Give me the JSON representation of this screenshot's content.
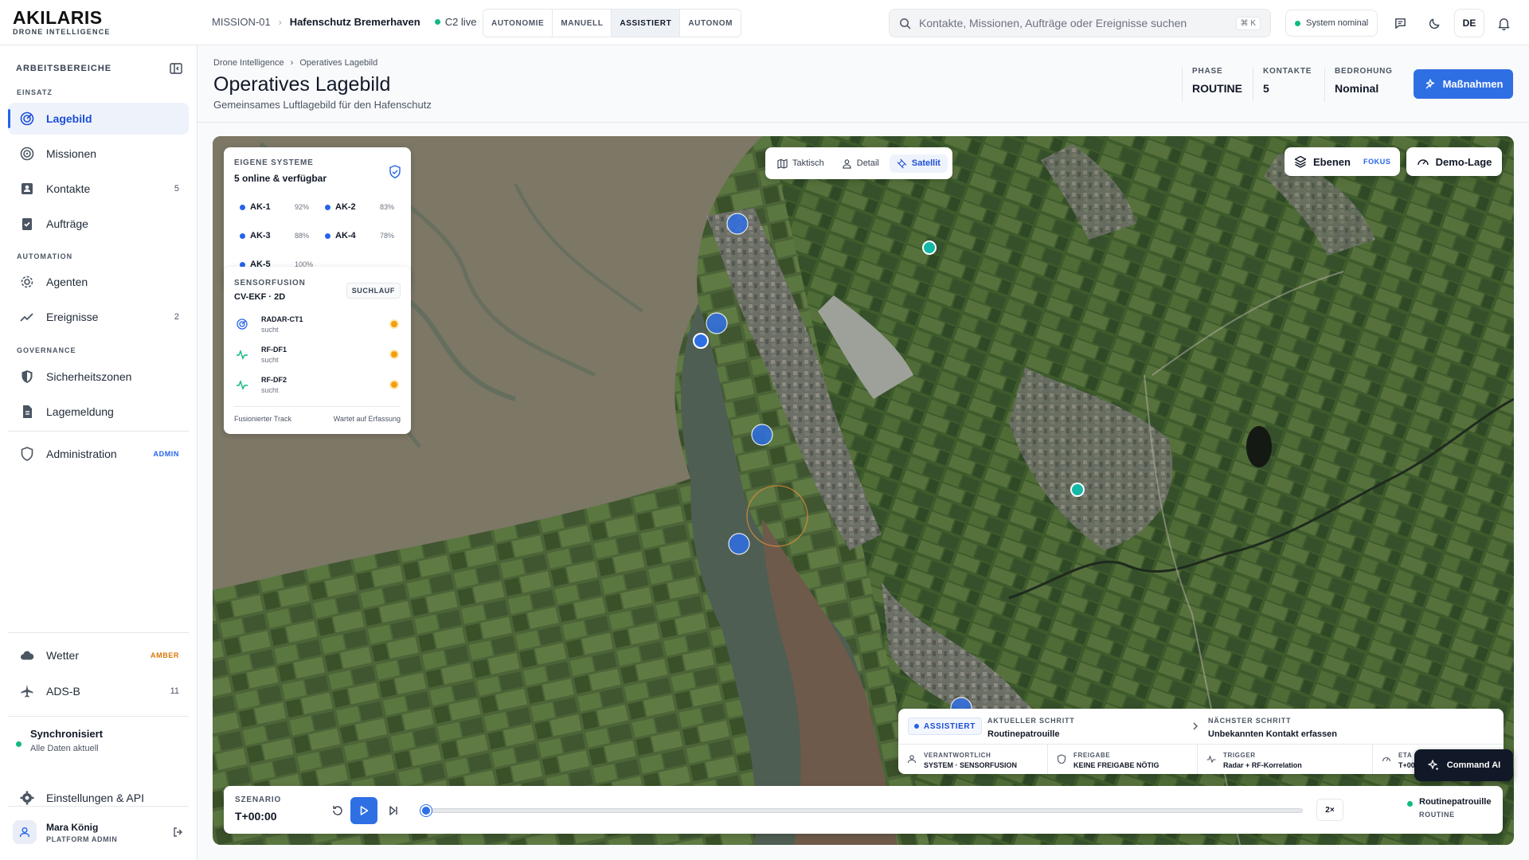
{
  "brand": {
    "name": "AKILARIS",
    "tagline": "DRONE INTELLIGENCE"
  },
  "topbar": {
    "mission": "MISSION-01",
    "site": "Hafenschutz Bremerhaven",
    "c2_status": "C2 live",
    "modes": [
      "AUTONOMIE",
      "MANUELL",
      "ASSISTIERT",
      "AUTONOM"
    ],
    "active_mode": "ASSISTIERT",
    "search_placeholder": "Kontakte, Missionen, Aufträge oder Ereignisse suchen",
    "search_shortcut": "⌘ K",
    "system_status": "System nominal",
    "language": "DE"
  },
  "sidebar": {
    "title": "ARBEITSBEREICHE",
    "sections": {
      "einsatz": "EINSATZ",
      "automation": "AUTOMATION",
      "governance": "GOVERNANCE"
    },
    "items": [
      {
        "label": "Lagebild",
        "icon": "radar-icon",
        "active": true
      },
      {
        "label": "Missionen",
        "icon": "target-icon"
      },
      {
        "label": "Kontakte",
        "icon": "contacts-icon",
        "count": "5"
      },
      {
        "label": "Aufträge",
        "icon": "clipboard-check-icon"
      },
      {
        "label": "Agenten",
        "icon": "gear-icon"
      },
      {
        "label": "Ereignisse",
        "icon": "trend-icon",
        "count": "2"
      },
      {
        "label": "Sicherheitszonen",
        "icon": "shield-half-icon"
      },
      {
        "label": "Lagemeldung",
        "icon": "document-icon"
      },
      {
        "label": "Administration",
        "icon": "shield-icon",
        "tag": "ADMIN"
      },
      {
        "label": "Wetter",
        "icon": "cloud-icon",
        "tag": "AMBER"
      },
      {
        "label": "ADS-B",
        "icon": "plane-icon",
        "count": "11"
      }
    ],
    "sync": {
      "title": "Synchronisiert",
      "detail": "Alle Daten aktuell"
    },
    "settings": "Einstellungen & API",
    "user": {
      "name": "Mara König",
      "role": "PLATFORM ADMIN"
    }
  },
  "header": {
    "breadcrumb": [
      "Drone Intelligence",
      "Operatives Lagebild"
    ],
    "title": "Operatives Lagebild",
    "subtitle": "Gemeinsames Luftlagebild für den Hafenschutz",
    "stats": [
      {
        "label": "PHASE",
        "value": "ROUTINE"
      },
      {
        "label": "KONTAKTE",
        "value": "5"
      },
      {
        "label": "BEDROHUNG",
        "value": "Nominal"
      }
    ],
    "action": "Maßnahmen"
  },
  "map": {
    "systems": {
      "label": "EIGENE SYSTEME",
      "summary": "5 online & verfügbar",
      "units": [
        {
          "id": "AK-1",
          "battery": "92%"
        },
        {
          "id": "AK-2",
          "battery": "83%"
        },
        {
          "id": "AK-3",
          "battery": "88%"
        },
        {
          "id": "AK-4",
          "battery": "78%"
        },
        {
          "id": "AK-5",
          "battery": "100%"
        }
      ]
    },
    "fusion": {
      "label": "SENSORFUSION",
      "model": "CV-EKF · 2D",
      "badge": "SUCHLAUF",
      "sensors": [
        {
          "name": "RADAR-CT1",
          "state": "sucht"
        },
        {
          "name": "RF-DF1",
          "state": "sucht"
        },
        {
          "name": "RF-DF2",
          "state": "sucht"
        }
      ],
      "footer_left": "Fusionierter Track",
      "footer_right": "Wartet auf Erfassung"
    },
    "views": [
      "Taktisch",
      "Detail",
      "Satellit"
    ],
    "active_view": "Satellit",
    "layers": {
      "label": "Ebenen",
      "tag": "FOKUS"
    },
    "demo": "Demo-Lage",
    "steps": {
      "mode": "ASSISTIERT",
      "current_label": "AKTUELLER SCHRITT",
      "current": "Routinepatrouille",
      "next_label": "NÄCHSTER SCHRITT",
      "next": "Unbekannten Kontakt erfassen",
      "cells": [
        {
          "label": "VERANTWORTLICH",
          "value": "SYSTEM · SENSORFUSION"
        },
        {
          "label": "FREIGABE",
          "value": "KEINE FREIGABE NÖTIG"
        },
        {
          "label": "TRIGGER",
          "value": "Radar + RF-Korrelation"
        },
        {
          "label": "ETA",
          "value": "T+00"
        }
      ]
    },
    "scenario": {
      "label": "SZENARIO",
      "time": "T+00:00",
      "progress": 0,
      "speed": "2×",
      "phase_name": "Routinepatrouille",
      "phase_tag": "ROUTINE"
    },
    "command_ai": "Command AI"
  },
  "colors": {
    "accent": "#2f6fe4",
    "status_ok": "#10b981",
    "warning": "#f59e0b",
    "admin_tag": "#2563eb",
    "amber_tag": "#d97706"
  }
}
